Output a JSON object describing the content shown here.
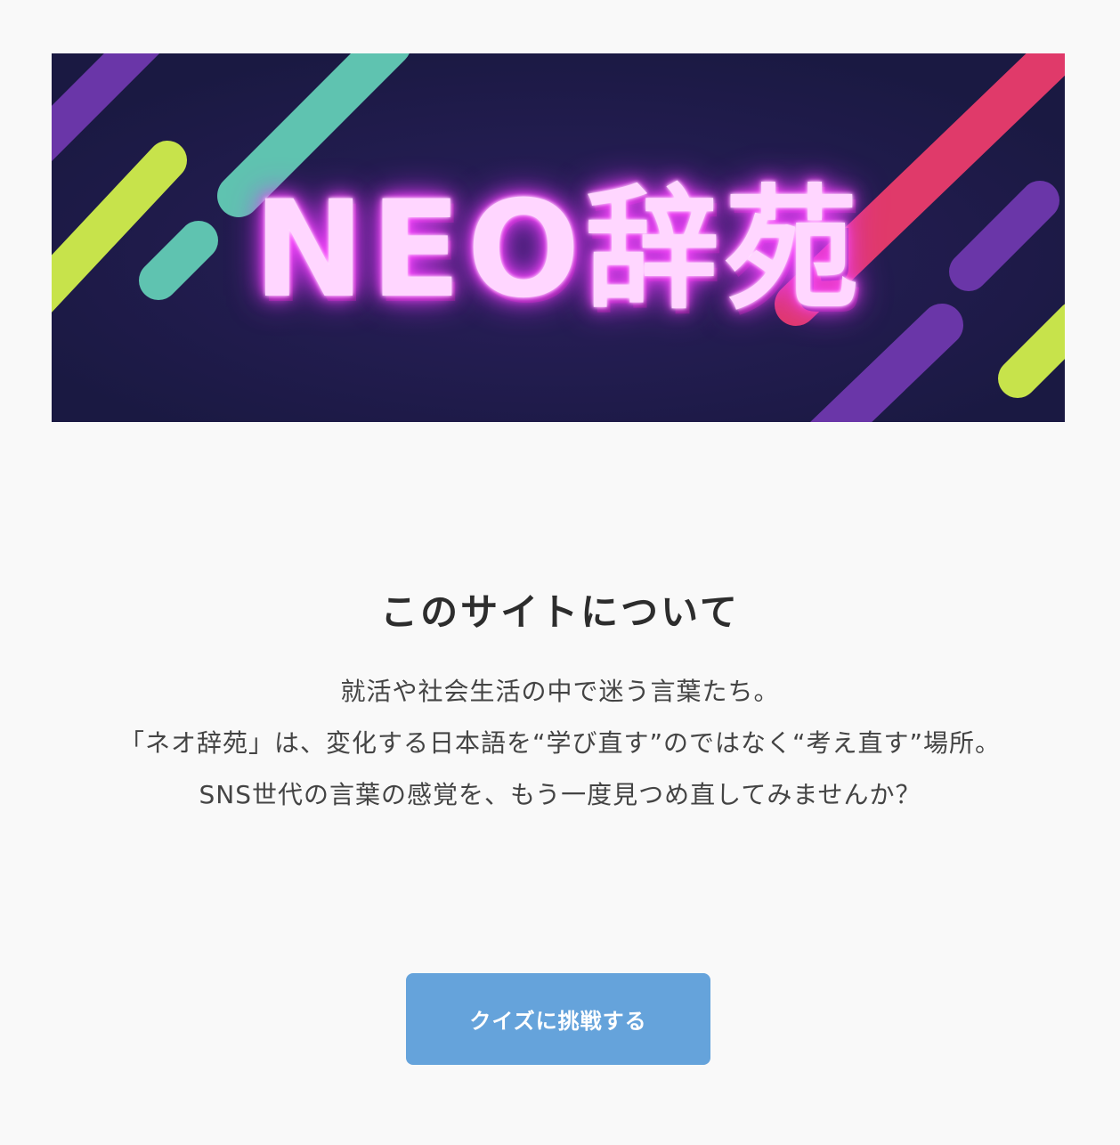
{
  "hero": {
    "logo_text": "NEO辞苑",
    "colors": {
      "background": "#1c1a45",
      "neon": "#ff4dff",
      "stripe_purple": "#6a36a8",
      "stripe_teal": "#5fc3b0",
      "stripe_lime": "#c7e34b",
      "stripe_pink": "#e03a6a"
    }
  },
  "about": {
    "title": "このサイトについて",
    "lines": [
      "就活や社会生活の中で迷う言葉たち。",
      "「ネオ辞苑」は、変化する日本語を“学び直す”のではなく“考え直す”場所。",
      "SNS世代の言葉の感覚を、もう一度見つめ直してみませんか？"
    ]
  },
  "cta": {
    "label": "クイズに挑戦する",
    "color": "#65a3db"
  }
}
